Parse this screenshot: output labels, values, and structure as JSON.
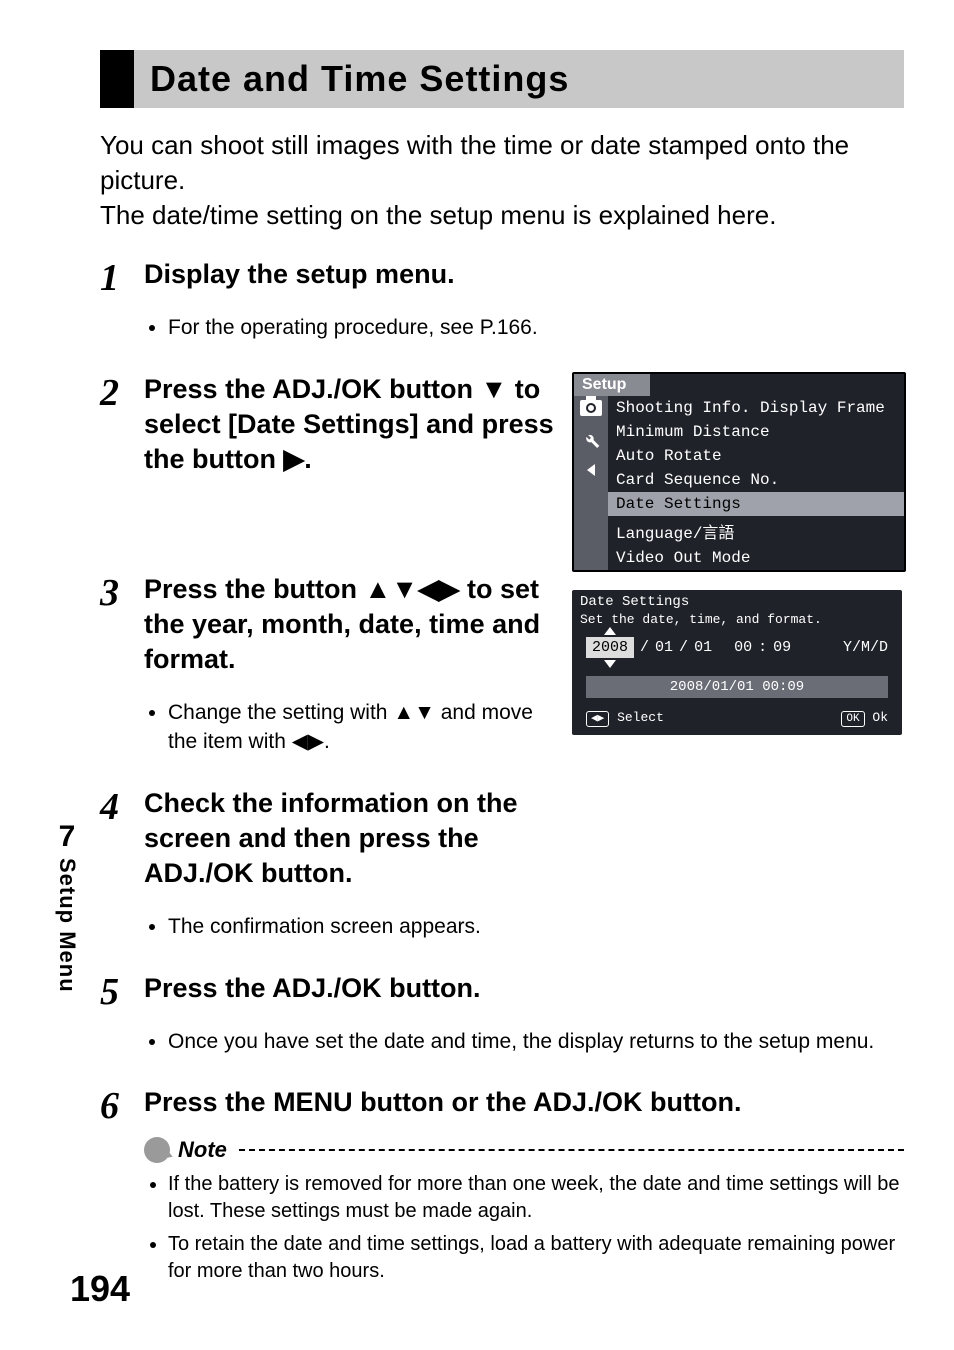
{
  "sidebar": {
    "chapter_num": "7",
    "chapter_label": "Setup Menu"
  },
  "page_number": "194",
  "header": {
    "title": "Date and Time Settings"
  },
  "intro": {
    "line1": "You can shoot still images with the time or date stamped onto the picture.",
    "line2": "The date/time setting on the setup menu is explained here."
  },
  "steps": {
    "s1": {
      "num": "1",
      "title": "Display the setup menu.",
      "bullet1": "For the operating procedure, see P.166."
    },
    "s2": {
      "num": "2",
      "title_pre": "Press the ADJ./OK button ",
      "title_mid": " to select [Date Settings] and press the button ",
      "title_post": "."
    },
    "s3": {
      "num": "3",
      "title_pre": "Press the button ",
      "title_post": " to set the year, month, date, time and format.",
      "bullet_pre": "Change the setting with ",
      "bullet_mid": " and move the item with ",
      "bullet_post": "."
    },
    "s4": {
      "num": "4",
      "title": "Check the information on the screen and then press the ADJ./OK button.",
      "bullet1": "The confirmation screen appears."
    },
    "s5": {
      "num": "5",
      "title": "Press the ADJ./OK button.",
      "bullet1": "Once you have set the date and time, the display returns to the setup menu."
    },
    "s6": {
      "num": "6",
      "title": "Press the MENU button or the ADJ./OK button."
    }
  },
  "setup_screenshot": {
    "tab": "Setup",
    "items": [
      "Shooting Info. Display Frame",
      "Minimum Distance",
      "Auto Rotate",
      "Card Sequence No.",
      "Date Settings",
      "Language/言語",
      "Video Out Mode"
    ],
    "selected_index": 4
  },
  "date_screenshot": {
    "header": "Date Settings",
    "subheader": "Set the date, time, and format.",
    "year": "2008",
    "sep1": "/",
    "month": "01",
    "sep2": "/",
    "day": "01",
    "hour": "00",
    "colon": ":",
    "minute": "09",
    "format": "Y/M/D",
    "preview": "2008/01/01 00:09",
    "left_key": "◀▶",
    "left_label": "Select",
    "right_key": "OK",
    "right_label": "Ok"
  },
  "note": {
    "label": "Note",
    "n1": "If the battery is removed for more than one week, the date and time settings will be lost. These settings must be made again.",
    "n2": "To retain the date and time settings, load a battery with adequate remaining power for more than two hours."
  }
}
